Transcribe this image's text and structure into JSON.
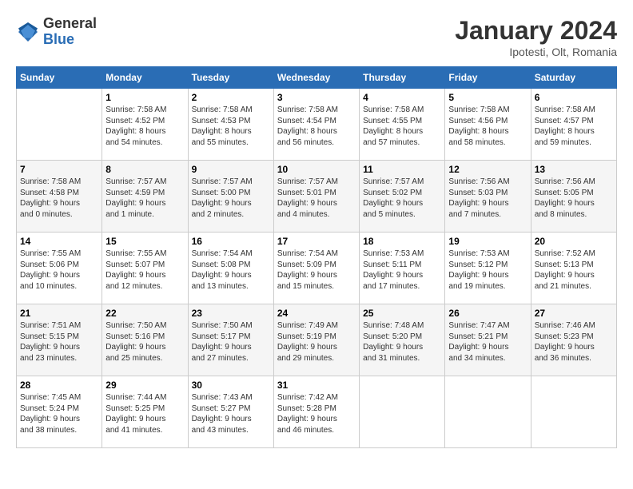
{
  "header": {
    "logo_general": "General",
    "logo_blue": "Blue",
    "month_year": "January 2024",
    "location": "Ipotesti, Olt, Romania"
  },
  "calendar": {
    "days_of_week": [
      "Sunday",
      "Monday",
      "Tuesday",
      "Wednesday",
      "Thursday",
      "Friday",
      "Saturday"
    ],
    "weeks": [
      [
        {
          "day": "",
          "info": ""
        },
        {
          "day": "1",
          "info": "Sunrise: 7:58 AM\nSunset: 4:52 PM\nDaylight: 8 hours\nand 54 minutes."
        },
        {
          "day": "2",
          "info": "Sunrise: 7:58 AM\nSunset: 4:53 PM\nDaylight: 8 hours\nand 55 minutes."
        },
        {
          "day": "3",
          "info": "Sunrise: 7:58 AM\nSunset: 4:54 PM\nDaylight: 8 hours\nand 56 minutes."
        },
        {
          "day": "4",
          "info": "Sunrise: 7:58 AM\nSunset: 4:55 PM\nDaylight: 8 hours\nand 57 minutes."
        },
        {
          "day": "5",
          "info": "Sunrise: 7:58 AM\nSunset: 4:56 PM\nDaylight: 8 hours\nand 58 minutes."
        },
        {
          "day": "6",
          "info": "Sunrise: 7:58 AM\nSunset: 4:57 PM\nDaylight: 8 hours\nand 59 minutes."
        }
      ],
      [
        {
          "day": "7",
          "info": "Sunrise: 7:58 AM\nSunset: 4:58 PM\nDaylight: 9 hours\nand 0 minutes."
        },
        {
          "day": "8",
          "info": "Sunrise: 7:57 AM\nSunset: 4:59 PM\nDaylight: 9 hours\nand 1 minute."
        },
        {
          "day": "9",
          "info": "Sunrise: 7:57 AM\nSunset: 5:00 PM\nDaylight: 9 hours\nand 2 minutes."
        },
        {
          "day": "10",
          "info": "Sunrise: 7:57 AM\nSunset: 5:01 PM\nDaylight: 9 hours\nand 4 minutes."
        },
        {
          "day": "11",
          "info": "Sunrise: 7:57 AM\nSunset: 5:02 PM\nDaylight: 9 hours\nand 5 minutes."
        },
        {
          "day": "12",
          "info": "Sunrise: 7:56 AM\nSunset: 5:03 PM\nDaylight: 9 hours\nand 7 minutes."
        },
        {
          "day": "13",
          "info": "Sunrise: 7:56 AM\nSunset: 5:05 PM\nDaylight: 9 hours\nand 8 minutes."
        }
      ],
      [
        {
          "day": "14",
          "info": "Sunrise: 7:55 AM\nSunset: 5:06 PM\nDaylight: 9 hours\nand 10 minutes."
        },
        {
          "day": "15",
          "info": "Sunrise: 7:55 AM\nSunset: 5:07 PM\nDaylight: 9 hours\nand 12 minutes."
        },
        {
          "day": "16",
          "info": "Sunrise: 7:54 AM\nSunset: 5:08 PM\nDaylight: 9 hours\nand 13 minutes."
        },
        {
          "day": "17",
          "info": "Sunrise: 7:54 AM\nSunset: 5:09 PM\nDaylight: 9 hours\nand 15 minutes."
        },
        {
          "day": "18",
          "info": "Sunrise: 7:53 AM\nSunset: 5:11 PM\nDaylight: 9 hours\nand 17 minutes."
        },
        {
          "day": "19",
          "info": "Sunrise: 7:53 AM\nSunset: 5:12 PM\nDaylight: 9 hours\nand 19 minutes."
        },
        {
          "day": "20",
          "info": "Sunrise: 7:52 AM\nSunset: 5:13 PM\nDaylight: 9 hours\nand 21 minutes."
        }
      ],
      [
        {
          "day": "21",
          "info": "Sunrise: 7:51 AM\nSunset: 5:15 PM\nDaylight: 9 hours\nand 23 minutes."
        },
        {
          "day": "22",
          "info": "Sunrise: 7:50 AM\nSunset: 5:16 PM\nDaylight: 9 hours\nand 25 minutes."
        },
        {
          "day": "23",
          "info": "Sunrise: 7:50 AM\nSunset: 5:17 PM\nDaylight: 9 hours\nand 27 minutes."
        },
        {
          "day": "24",
          "info": "Sunrise: 7:49 AM\nSunset: 5:19 PM\nDaylight: 9 hours\nand 29 minutes."
        },
        {
          "day": "25",
          "info": "Sunrise: 7:48 AM\nSunset: 5:20 PM\nDaylight: 9 hours\nand 31 minutes."
        },
        {
          "day": "26",
          "info": "Sunrise: 7:47 AM\nSunset: 5:21 PM\nDaylight: 9 hours\nand 34 minutes."
        },
        {
          "day": "27",
          "info": "Sunrise: 7:46 AM\nSunset: 5:23 PM\nDaylight: 9 hours\nand 36 minutes."
        }
      ],
      [
        {
          "day": "28",
          "info": "Sunrise: 7:45 AM\nSunset: 5:24 PM\nDaylight: 9 hours\nand 38 minutes."
        },
        {
          "day": "29",
          "info": "Sunrise: 7:44 AM\nSunset: 5:25 PM\nDaylight: 9 hours\nand 41 minutes."
        },
        {
          "day": "30",
          "info": "Sunrise: 7:43 AM\nSunset: 5:27 PM\nDaylight: 9 hours\nand 43 minutes."
        },
        {
          "day": "31",
          "info": "Sunrise: 7:42 AM\nSunset: 5:28 PM\nDaylight: 9 hours\nand 46 minutes."
        },
        {
          "day": "",
          "info": ""
        },
        {
          "day": "",
          "info": ""
        },
        {
          "day": "",
          "info": ""
        }
      ]
    ]
  }
}
